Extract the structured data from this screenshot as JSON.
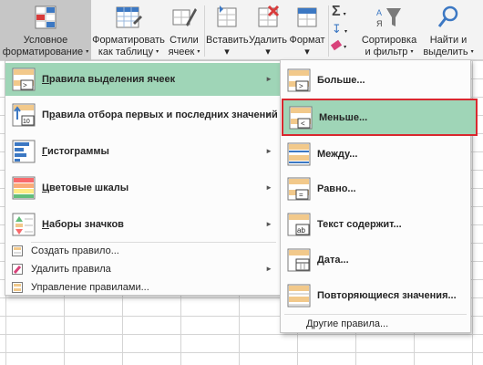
{
  "ribbon": {
    "conditional_formatting": {
      "line1": "Условное",
      "line2": "форматирование"
    },
    "format_as_table": {
      "line1": "Форматировать",
      "line2": "как таблицу"
    },
    "cell_styles": {
      "line1": "Стили",
      "line2": "ячеек"
    },
    "insert": {
      "line1": "Вставить"
    },
    "delete": {
      "line1": "Удалить"
    },
    "format": {
      "line1": "Формат"
    },
    "sort_filter": {
      "line1": "Сортировка",
      "line2": "и фильтр"
    },
    "find_select": {
      "line1": "Найти и",
      "line2": "выделить"
    },
    "caret": "▾",
    "sigma": "Σ"
  },
  "main_menu": {
    "items": [
      {
        "label": "Правила выделения ячеек",
        "underline": "П"
      },
      {
        "label": "Правила отбора первых и последних значений",
        "underline": "р"
      },
      {
        "label": "Гистограммы",
        "underline": "Г"
      },
      {
        "label": "Цветовые шкалы",
        "underline": "Ц"
      },
      {
        "label": "Наборы значков",
        "underline": "Н"
      }
    ],
    "small_items": [
      {
        "label": "Создать правило..."
      },
      {
        "label": "Удалить правила"
      },
      {
        "label": "Управление правилами..."
      }
    ],
    "arrow": "►"
  },
  "sub_menu": {
    "items": [
      {
        "label": "Больше..."
      },
      {
        "label": "Меньше..."
      },
      {
        "label": "Между..."
      },
      {
        "label": "Равно..."
      },
      {
        "label": "Текст содержит..."
      },
      {
        "label": "Дата..."
      },
      {
        "label": "Повторяющиеся значения..."
      }
    ],
    "other_rules": "Другие правила..."
  },
  "colors": {
    "highlight": "#9fd5b7",
    "highlight_border": "#d9282f",
    "ribbon_bg": "#f3f3f3"
  }
}
